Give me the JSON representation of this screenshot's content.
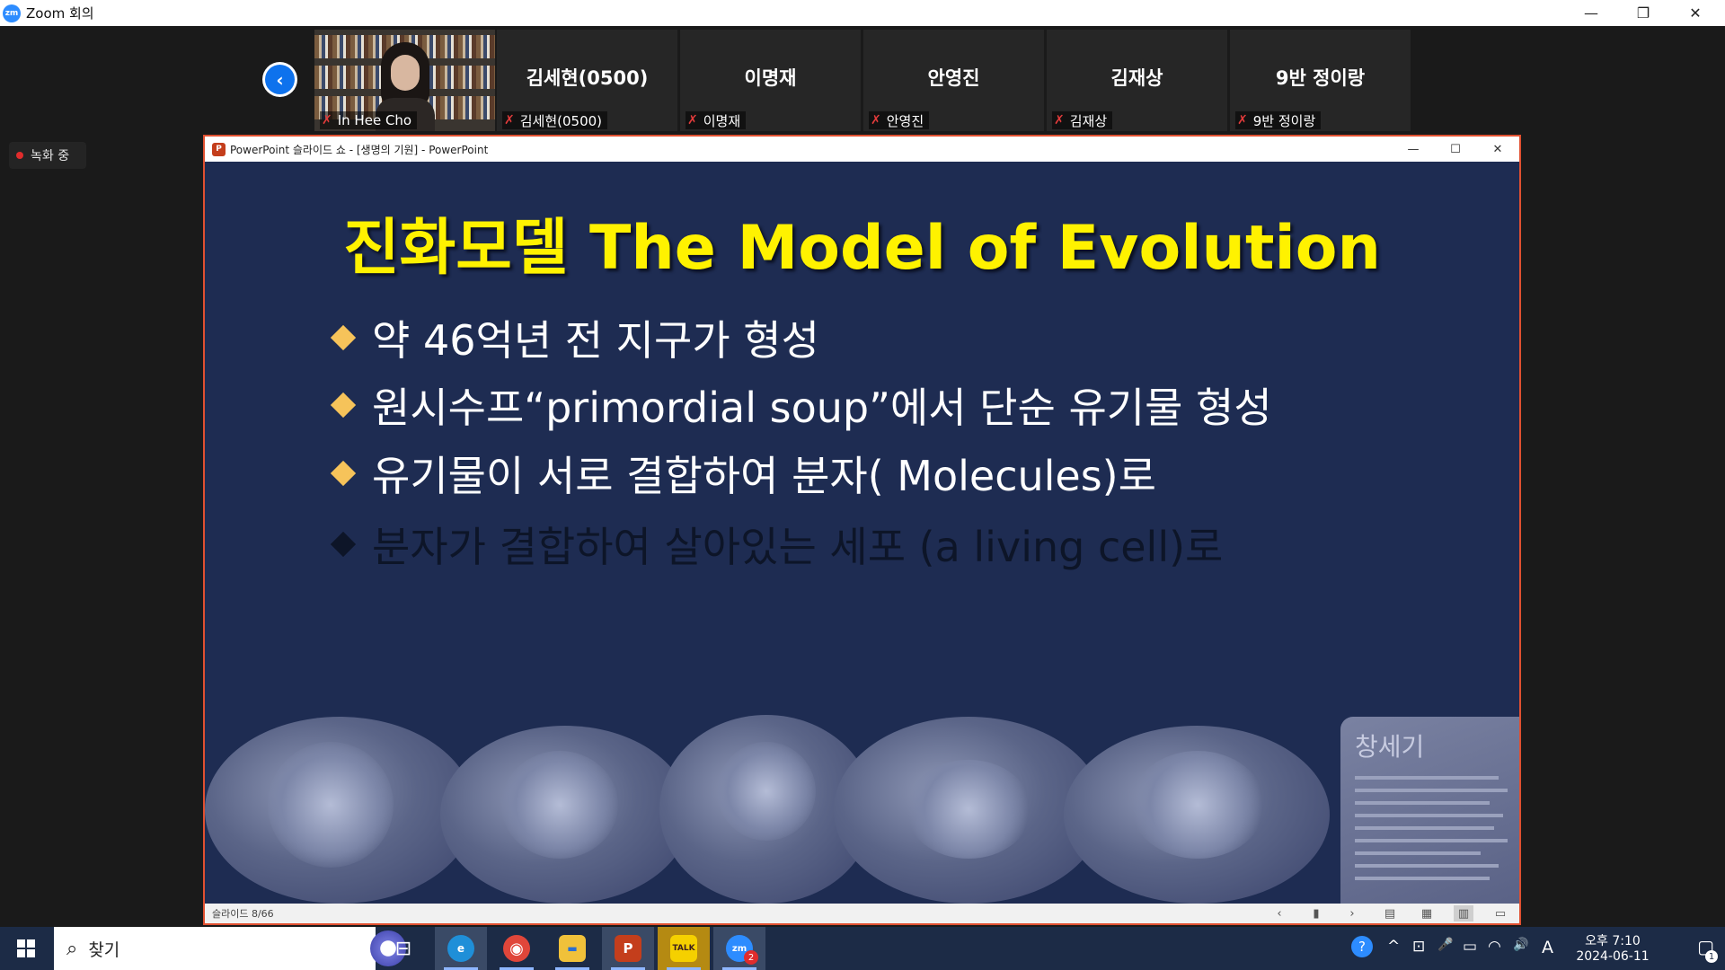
{
  "zoom": {
    "window_title": "Zoom 회의",
    "logo_text": "zm",
    "controls": {
      "minimize": "—",
      "restore": "❐",
      "close": "✕"
    }
  },
  "participants": {
    "back_icon": "‹",
    "video_tile": {
      "name": "In Hee Cho"
    },
    "tiles": [
      {
        "display": "김세현(0500)",
        "label": "김세현(0500)"
      },
      {
        "display": "이명재",
        "label": "이명재"
      },
      {
        "display": "안영진",
        "label": "안영진"
      },
      {
        "display": "김재상",
        "label": "김재상"
      },
      {
        "display": "9반 정이랑",
        "label": "9반 정이랑"
      }
    ],
    "mic_icon": "✗"
  },
  "recording": {
    "label": "녹화 중"
  },
  "powerpoint": {
    "icon_text": "P",
    "window_title": "PowerPoint 슬라이드 쇼 - [생명의 기원] - PowerPoint",
    "controls": {
      "minimize": "—",
      "maximize": "☐",
      "close": "✕"
    },
    "slide": {
      "title": "진화모델 The Model of Evolution",
      "bullets": [
        " 약 46억년 전 지구가 형성",
        "원시수프“primordial soup”에서 단순 유기물 형성",
        "유기물이 서로 결합하여 분자( Molecules)로",
        "분자가 결합하여 살아있는 세포 (a living cell)로"
      ],
      "image_text": "창세기"
    },
    "status": {
      "slide_counter": "슬라이드 8/66",
      "prev": "‹",
      "menu": "▮",
      "next": "›",
      "view_normal": "▤",
      "view_sorter": "▦",
      "view_reading": "▥",
      "view_slideshow": "▭"
    }
  },
  "taskbar": {
    "search_icon": "⌕",
    "search_placeholder": "찾기",
    "taskview_icon": "⊟",
    "apps": [
      {
        "name": "Edge",
        "glyph": "e",
        "color": "#1f8fd8"
      },
      {
        "name": "Chrome",
        "glyph": "◉",
        "color": "#e0463a"
      },
      {
        "name": "File Explorer",
        "glyph": "▬",
        "color": "#f0c13a"
      },
      {
        "name": "PowerPoint",
        "glyph": "P",
        "color": "#c43e1c"
      },
      {
        "name": "KakaoTalk",
        "glyph": "TALK",
        "color": "#f5d000"
      },
      {
        "name": "Zoom",
        "glyph": "zm",
        "color": "#2d8cff"
      }
    ],
    "zoom_badge": "2",
    "tray": {
      "help": "?",
      "chevron": "^",
      "meet": "⊡",
      "mic": "🎤",
      "battery": "▭",
      "wifi": "◠",
      "volume": "🔊",
      "ime": "A"
    },
    "clock": {
      "time": "오후 7:10",
      "date": "2024-06-11"
    },
    "notification_icon": "▢",
    "notification_count": "1"
  }
}
